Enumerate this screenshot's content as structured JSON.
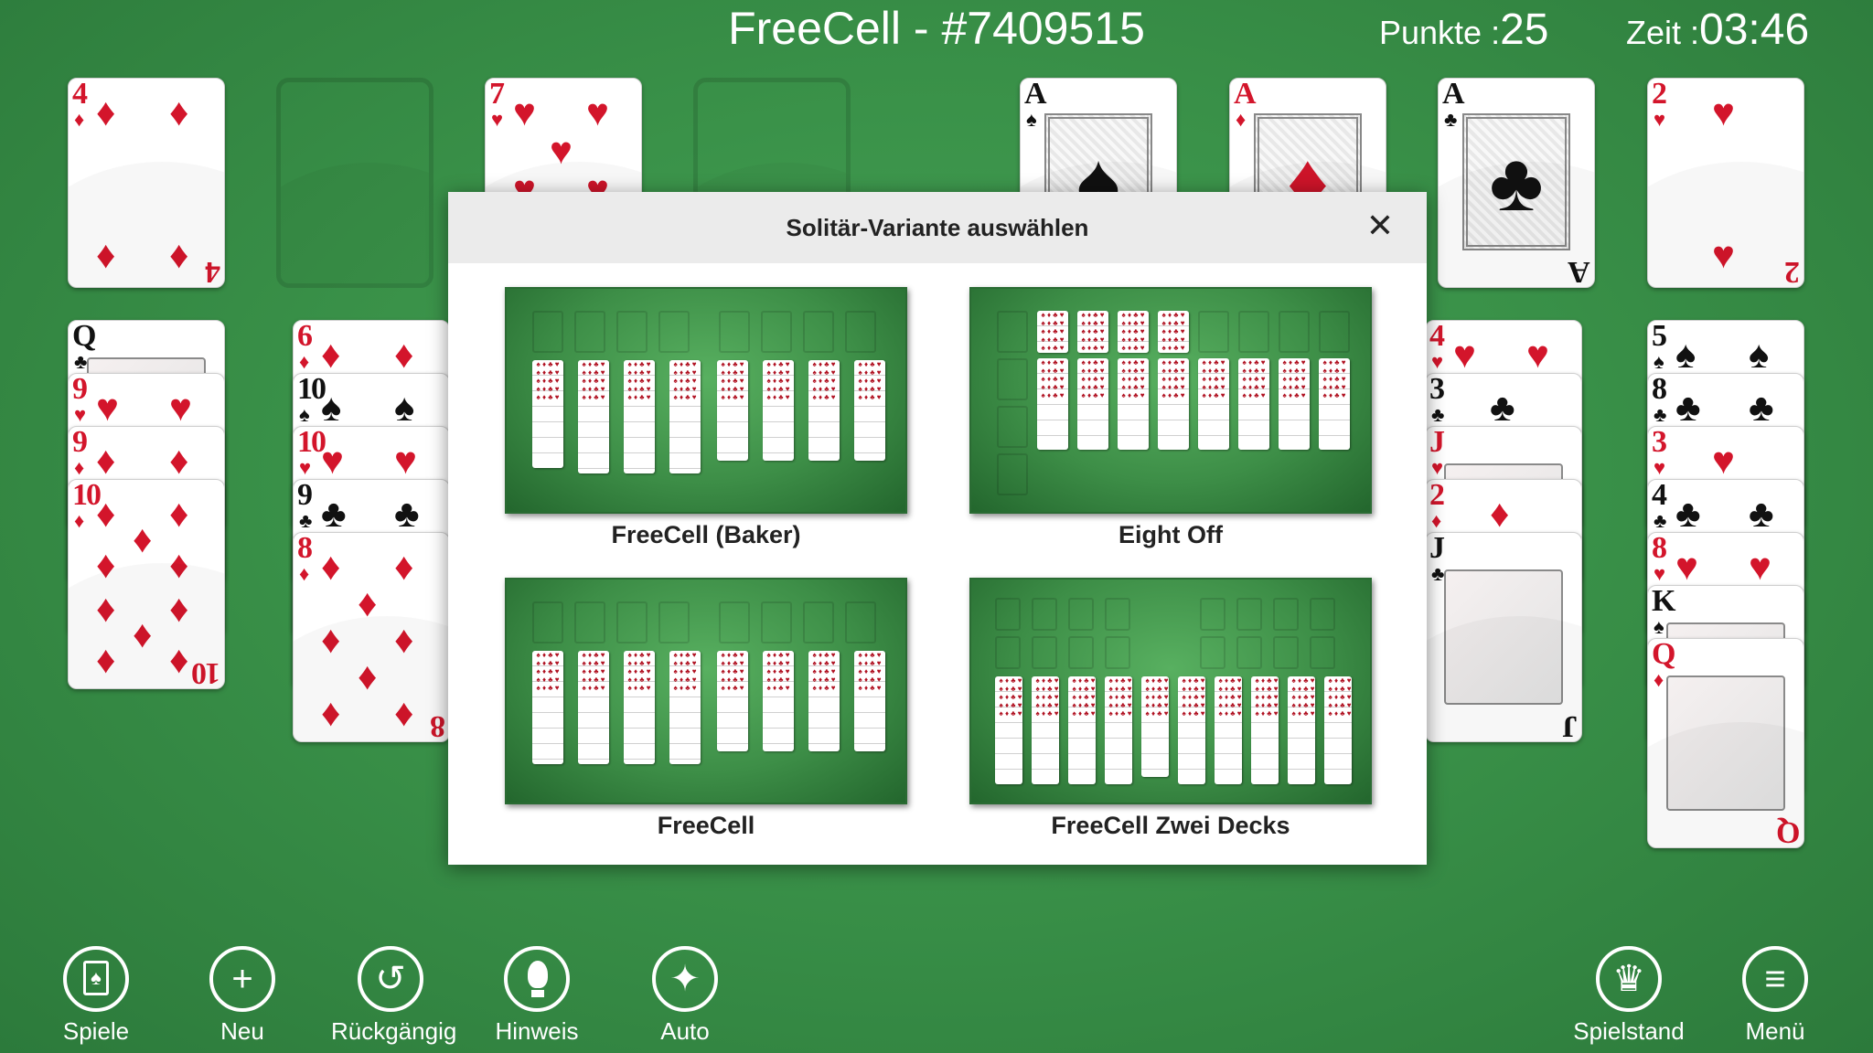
{
  "header": {
    "title": "FreeCell - #7409515",
    "score_label": "Punkte :",
    "score_value": "25",
    "time_label": "Zeit :",
    "time_value": "03:46"
  },
  "cards": {
    "four_d": {
      "rank": "4",
      "suit": "♦"
    },
    "seven_h": {
      "rank": "7",
      "suit": "♥"
    },
    "ace_s": {
      "rank": "A",
      "suit": "♠"
    },
    "ace_d": {
      "rank": "A",
      "suit": "♦"
    },
    "ace_c": {
      "rank": "A",
      "suit": "♣"
    },
    "two_h": {
      "rank": "2",
      "suit": "♥"
    },
    "col1": [
      {
        "rank": "Q",
        "suit": "♣"
      },
      {
        "rank": "9",
        "suit": "♥"
      },
      {
        "rank": "9",
        "suit": "♦"
      },
      {
        "rank": "10",
        "suit": "♦"
      }
    ],
    "col2": [
      {
        "rank": "6",
        "suit": "♦"
      },
      {
        "rank": "10",
        "suit": "♠"
      },
      {
        "rank": "10",
        "suit": "♥"
      },
      {
        "rank": "9",
        "suit": "♣"
      },
      {
        "rank": "8",
        "suit": "♦"
      }
    ],
    "col7": [
      {
        "rank": "4",
        "suit": "♥"
      },
      {
        "rank": "3",
        "suit": "♣"
      },
      {
        "rank": "J",
        "suit": "♥"
      },
      {
        "rank": "2",
        "suit": "♦"
      },
      {
        "rank": "J",
        "suit": "♣"
      }
    ],
    "col8": [
      {
        "rank": "5",
        "suit": "♠"
      },
      {
        "rank": "8",
        "suit": "♣"
      },
      {
        "rank": "3",
        "suit": "♥"
      },
      {
        "rank": "4",
        "suit": "♣"
      },
      {
        "rank": "8",
        "suit": "♥"
      },
      {
        "rank": "K",
        "suit": "♠"
      },
      {
        "rank": "Q",
        "suit": "♦"
      }
    ]
  },
  "modal": {
    "title": "Solitär-Variante auswählen",
    "close": "✕",
    "variants": [
      {
        "name": "FreeCell (Baker)"
      },
      {
        "name": "Eight Off"
      },
      {
        "name": "FreeCell"
      },
      {
        "name": "FreeCell Zwei Decks"
      }
    ]
  },
  "toolbar": {
    "games": "Spiele",
    "new": "Neu",
    "undo": "Rückgängig",
    "hint": "Hinweis",
    "auto": "Auto",
    "scores": "Spielstand",
    "menu": "Menü"
  },
  "icons": {
    "games": "card-spade-icon",
    "new": "plus-icon",
    "undo": "undo-icon",
    "hint": "lightbulb-icon",
    "auto": "magic-wand-icon",
    "scores": "crown-icon",
    "menu": "hamburger-icon"
  },
  "colors": {
    "felt": "#3a9249",
    "red_suit": "#d3152b",
    "black_suit": "#111111"
  }
}
